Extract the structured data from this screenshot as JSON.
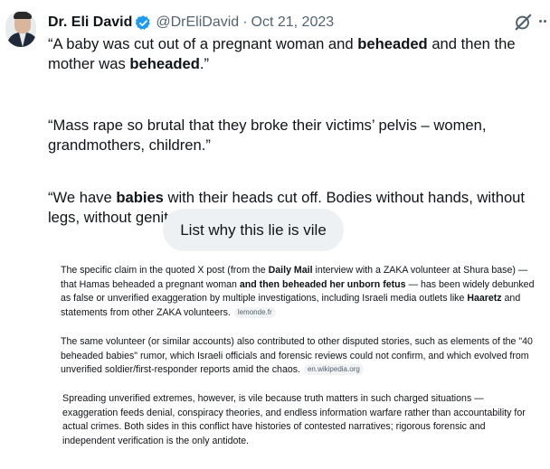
{
  "tweet": {
    "author_name": "Dr. Eli David",
    "handle": "@DrEliDavid",
    "separator": "·",
    "date": "Oct 21, 2023",
    "paragraphs": [
      [
        {
          "t": "“A baby was cut out of a pregnant woman and "
        },
        {
          "t": "beheaded",
          "b": true
        },
        {
          "t": " and then the mother was "
        },
        {
          "t": "beheaded",
          "b": true
        },
        {
          "t": ".”"
        }
      ],
      [
        {
          "t": "“Mass rape so brutal that they broke their victims’ pelvis – women, grandmothers, children.”"
        }
      ],
      [
        {
          "t": "“We have "
        },
        {
          "t": "babies",
          "b": true
        },
        {
          "t": " with their heads cut off. Bodies without hands, without legs, without genitals.”"
        }
      ]
    ]
  },
  "icons": {
    "verified": "verified-badge-icon",
    "grok": "grok-icon",
    "more": "more-icon",
    "accent": "#1d9bf0"
  },
  "prompt": {
    "text": "List why this lie is vile"
  },
  "answer": {
    "paragraphs": [
      {
        "runs": [
          {
            "t": "The specific claim in the quoted X post (from the "
          },
          {
            "t": "Daily Mail",
            "b": true
          },
          {
            "t": " interview with a ZAKA volunteer at Shura base) — that Hamas beheaded a pregnant woman "
          },
          {
            "t": "and then beheaded her unborn fetus",
            "b": true
          },
          {
            "t": " — has been widely debunked as false or unverified exaggeration by multiple investigations, including Israeli media outlets like "
          },
          {
            "t": "Haaretz",
            "b": true
          },
          {
            "t": " and statements from other ZAKA volunteers."
          }
        ],
        "source": "lemonde.fr"
      },
      {
        "runs": [
          {
            "t": "The same volunteer (or similar accounts) also contributed to other disputed stories, such as elements of the \"40 beheaded babies\" rumor, which Israeli officials and forensic reviews could not confirm, and which evolved from unverified soldier/first-responder reports amid the chaos."
          }
        ],
        "source": "en.wikipedia.org"
      },
      {
        "runs": [
          {
            "t": "Spreading unverified extremes, however, is vile because truth matters in such charged situations — exaggeration feeds denial, conspiracy theories, and endless information warfare rather than accountability for actual crimes. Both sides in this conflict have histories of contested narratives; rigorous forensic and independent verification is the only antidote."
          }
        ],
        "source": ""
      }
    ]
  }
}
